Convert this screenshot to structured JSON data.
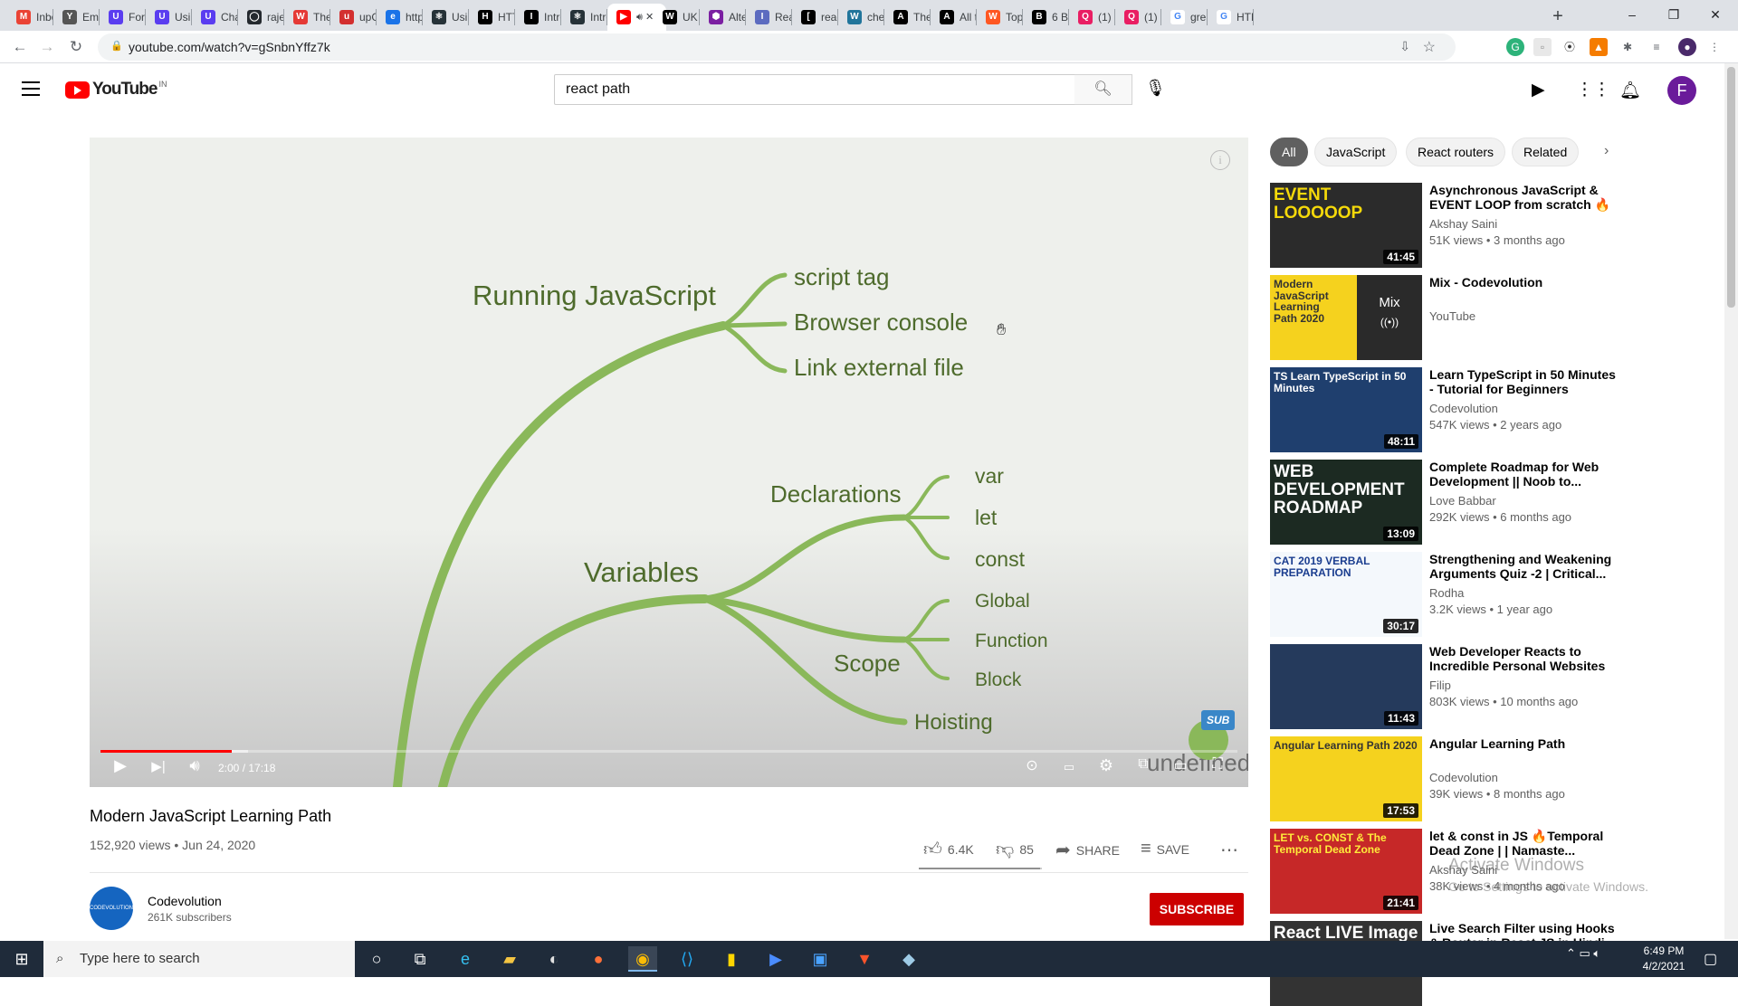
{
  "browser": {
    "tabs": [
      {
        "label": "Inbo",
        "color": "#ea4335",
        "glyph": "M"
      },
      {
        "label": "Emp",
        "color": "#555555",
        "glyph": "Y"
      },
      {
        "label": "Forr",
        "color": "#5a3df0",
        "glyph": "U"
      },
      {
        "label": "Usin",
        "color": "#5a3df0",
        "glyph": "U"
      },
      {
        "label": "Cha",
        "color": "#5a3df0",
        "glyph": "U"
      },
      {
        "label": "rajes",
        "color": "#24292e",
        "glyph": "◯"
      },
      {
        "label": "The",
        "color": "#e53935",
        "glyph": "W"
      },
      {
        "label": "upG",
        "color": "#d32f2f",
        "glyph": "u"
      },
      {
        "label": "http",
        "color": "#1a73e8",
        "glyph": "e"
      },
      {
        "label": "Usin",
        "color": "#263238",
        "glyph": "⚛"
      },
      {
        "label": "HTT",
        "color": "#000000",
        "glyph": "H"
      },
      {
        "label": "Intro",
        "color": "#000000",
        "glyph": "I"
      },
      {
        "label": "Intro",
        "color": "#263238",
        "glyph": "⚛"
      },
      {
        "label": "",
        "color": "#ff0000",
        "glyph": "▶",
        "active": true
      },
      {
        "label": "UK",
        "color": "#000000",
        "glyph": "W"
      },
      {
        "label": "Alte",
        "color": "#7b1fa2",
        "glyph": "⬢"
      },
      {
        "label": "Rea",
        "color": "#5c6bc0",
        "glyph": "I"
      },
      {
        "label": "reac",
        "color": "#000000",
        "glyph": "["
      },
      {
        "label": "che",
        "color": "#21759b",
        "glyph": "W"
      },
      {
        "label": "The",
        "color": "#000000",
        "glyph": "A"
      },
      {
        "label": "All t",
        "color": "#000000",
        "glyph": "A"
      },
      {
        "label": "Top",
        "color": "#ff5722",
        "glyph": "W"
      },
      {
        "label": "6 Be",
        "color": "#000000",
        "glyph": "B"
      },
      {
        "label": "(1) I",
        "color": "#e91e63",
        "glyph": "Q"
      },
      {
        "label": "(1) I",
        "color": "#e91e63",
        "glyph": "Q"
      },
      {
        "label": "grea",
        "color": "#ffffff",
        "glyph": "G"
      },
      {
        "label": "HTM",
        "color": "#ffffff",
        "glyph": "G"
      }
    ],
    "new_tab": "+",
    "url": "youtube.com/watch?v=gSnbnYffz7k",
    "window_controls": [
      "–",
      "❐",
      "✕"
    ]
  },
  "youtube": {
    "logo_text": "YouTube",
    "logo_region": "IN",
    "search_value": "react path",
    "avatar_letter": "F"
  },
  "video": {
    "title": "Modern JavaScript Learning Path",
    "meta": "152,920 views • Jun 24, 2020",
    "time": "2:00 / 17:18",
    "progress": 0.1156,
    "buffered": 0.13,
    "likes": "6.4K",
    "dislikes": "85",
    "like_ratio": 0.987,
    "share": "SHARE",
    "save": "SAVE",
    "sub_badge": "SUB",
    "mindmap": {
      "running": "Running JavaScript",
      "script_tag": "script tag",
      "browser_console": "Browser console",
      "link_external": "Link external file",
      "declarations": "Declarations",
      "var": "var",
      "let": "let",
      "const": "const",
      "variables": "Variables",
      "scope": "Scope",
      "global": "Global",
      "function": "Function",
      "block": "Block",
      "hoisting": "Hoisting",
      "overlay": "undefined"
    },
    "channel_name": "Codevolution",
    "channel_subs": "261K subscribers",
    "channel_avatar_text": "CODEVOLUTION",
    "subscribe": "SUBSCRIBE"
  },
  "chips": [
    "All",
    "JavaScript",
    "React routers",
    "Related"
  ],
  "recommendations": [
    {
      "title": "Asynchronous JavaScript & EVENT LOOP from scratch 🔥 |...",
      "channel": "Akshay Saini",
      "meta": "51K views • 3 months ago",
      "duration": "41:45",
      "thumb_text": "EVENT LOOOOOP",
      "bg": "#2b2b2b",
      "fg": "#f5d90a"
    },
    {
      "title": "Mix - Codevolution",
      "channel": "YouTube",
      "meta": "",
      "duration": "",
      "thumb_text": "Modern JavaScript Learning Path 2020",
      "bg": "#f5d21e",
      "fg": "#333333",
      "mix": "Mix"
    },
    {
      "title": "Learn TypeScript in 50 Minutes - Tutorial for Beginners",
      "channel": "Codevolution",
      "meta": "547K views • 2 years ago",
      "duration": "48:11",
      "thumb_text": "TS Learn TypeScript in 50 Minutes",
      "bg": "#1f3f6e",
      "fg": "#ffffff"
    },
    {
      "title": "Complete Roadmap for Web Development || Noob to...",
      "channel": "Love Babbar",
      "meta": "292K views • 6 months ago",
      "duration": "13:09",
      "thumb_text": "WEB DEVELOPMENT ROADMAP",
      "bg": "#1c2a22",
      "fg": "#ffffff"
    },
    {
      "title": "Strengthening and Weakening Arguments Quiz -2 | Critical...",
      "channel": "Rodha",
      "meta": "3.2K views • 1 year ago",
      "duration": "30:17",
      "thumb_text": "CAT 2019 VERBAL PREPARATION",
      "bg": "#f4f8fc",
      "fg": "#1a3d8f"
    },
    {
      "title": "Web Developer Reacts to Incredible Personal Websites /...",
      "channel": "Filip",
      "meta": "803K views • 10 months ago",
      "duration": "11:43",
      "thumb_text": "",
      "bg": "#253a5c",
      "fg": "#ffffff"
    },
    {
      "title": "Angular Learning Path",
      "channel": "Codevolution",
      "meta": "39K views • 8 months ago",
      "duration": "17:53",
      "thumb_text": "Angular Learning Path 2020",
      "bg": "#f5d21e",
      "fg": "#333333"
    },
    {
      "title": "let & const in JS 🔥Temporal Dead Zone | | Namaste...",
      "channel": "Akshay Saini",
      "meta": "38K views • 4 months ago",
      "duration": "21:41",
      "thumb_text": "LET vs. CONST & The Temporal Dead Zone",
      "bg": "#c62828",
      "fg": "#ffeb3b"
    },
    {
      "title": "Live Search Filter using Hooks & Router in React JS in Hindi in...",
      "channel": "",
      "meta": "",
      "duration": "",
      "thumb_text": "React LIVE Image Search",
      "bg": "#333333",
      "fg": "#ffffff"
    }
  ],
  "os": {
    "search_placeholder": "Type here to search",
    "time": "6:49 PM",
    "date": "4/2/2021",
    "activate_title": "Activate Windows",
    "activate_sub": "Go to Settings to activate Windows."
  },
  "colors": {
    "brand_red": "#ff0000",
    "subscribe_red": "#cc0000",
    "branch_green": "#8ab85a",
    "mindmap_text": "#4e6b2c"
  }
}
